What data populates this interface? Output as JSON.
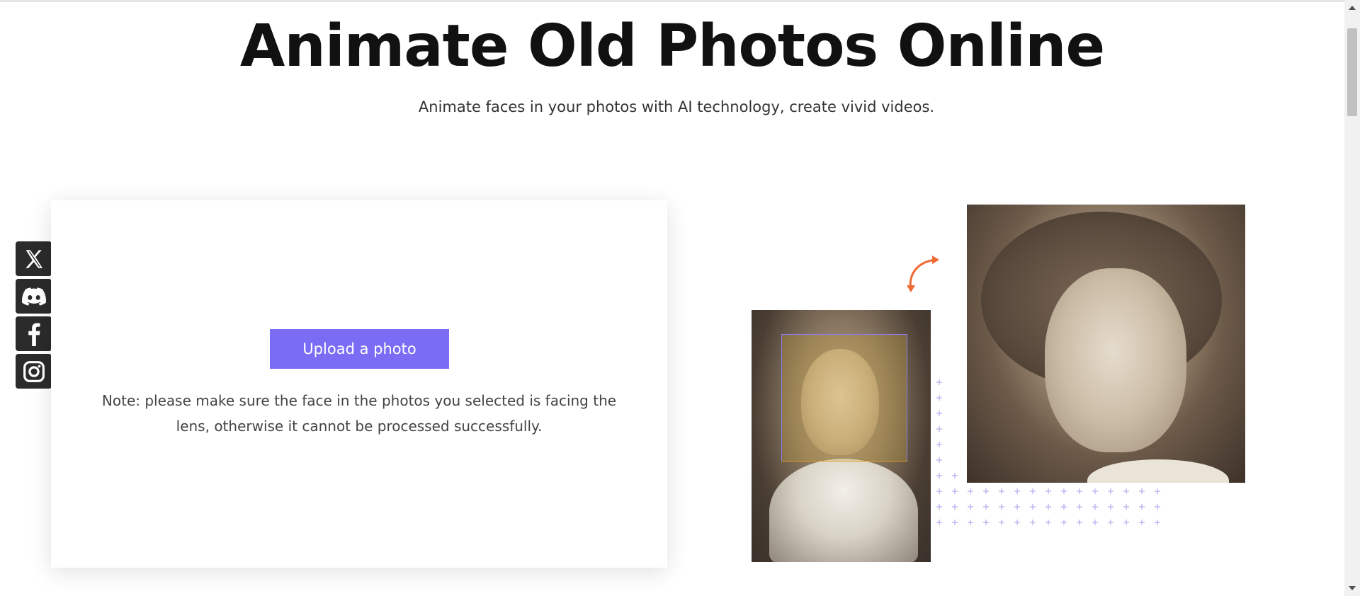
{
  "header": {
    "title": "Animate Old Photos Online",
    "subtitle": "Animate faces in your photos with AI technology, create vivid videos."
  },
  "social": [
    {
      "name": "x-icon"
    },
    {
      "name": "discord-icon"
    },
    {
      "name": "facebook-icon"
    },
    {
      "name": "instagram-icon"
    }
  ],
  "upload": {
    "button_label": "Upload a photo",
    "note": "Note: please make sure the face in the photos you selected is facing the lens, otherwise it cannot be processed successfully."
  },
  "colors": {
    "accent": "#7b6cf6",
    "arrow": "#f06a35",
    "social_bg": "#2b2b2b"
  }
}
